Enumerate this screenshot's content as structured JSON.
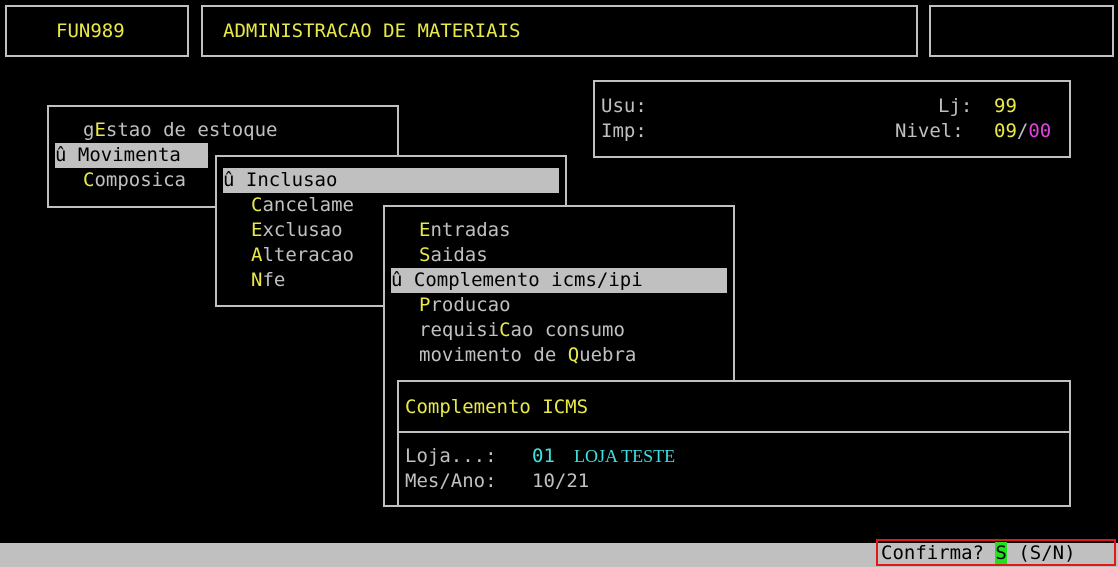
{
  "header": {
    "code": "FUN989",
    "title": "ADMINISTRACAO DE MATERIAIS",
    "right": ""
  },
  "user_info": {
    "usu_label": "Usu:",
    "imp_label": "Imp:",
    "lj_label": "Lj:",
    "lj_value": "99",
    "nivel_label": "Nivel:",
    "nivel_value_a": "09",
    "nivel_sep": "/",
    "nivel_value_b": "00"
  },
  "menu1": {
    "items": [
      {
        "pre": "g",
        "hot": "E",
        "post": "stao de estoque"
      },
      {
        "marker": "û ",
        "hot": "M",
        "post": "ovimenta"
      },
      {
        "hot": "C",
        "post": "omposica"
      }
    ]
  },
  "menu2": {
    "items": [
      {
        "marker": "û ",
        "hot": "I",
        "post": "nclusao"
      },
      {
        "hot": "C",
        "post": "ancelame"
      },
      {
        "hot": "E",
        "post": "xclusao"
      },
      {
        "hot": "A",
        "post": "lteracao"
      },
      {
        "hot": "N",
        "post": "fe"
      }
    ]
  },
  "menu3": {
    "items": [
      {
        "hot": "E",
        "post": "ntradas"
      },
      {
        "hot": "S",
        "post": "aidas"
      },
      {
        "marker": "û ",
        "hot": "C",
        "post": "omplemento icms/ipi"
      },
      {
        "hot": "P",
        "post": "roducao"
      },
      {
        "pre": "requisi",
        "hot": "C",
        "post": "ao consumo"
      },
      {
        "pre": "movimento de ",
        "hot": "Q",
        "post": "uebra"
      }
    ]
  },
  "dialog": {
    "title": "Complemento ICMS",
    "loja_label": "Loja...:",
    "loja_code": "01",
    "loja_name": "LOJA TESTE",
    "mes_label": "Mes/Ano:",
    "mes_value": "10/21"
  },
  "status": {
    "prompt": "Confirma?",
    "answer": "S",
    "options": "(S/N)"
  }
}
